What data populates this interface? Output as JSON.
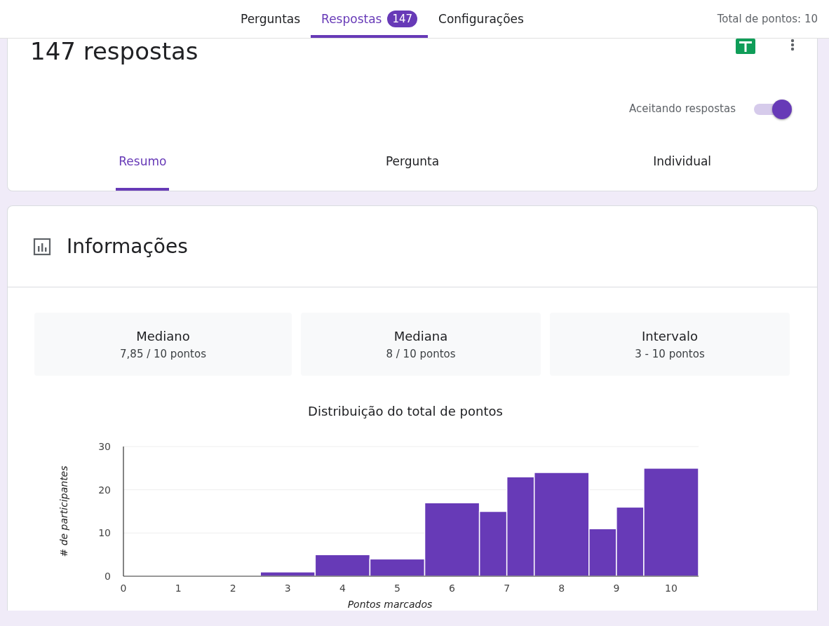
{
  "top_tabs": [
    {
      "label": "Perguntas",
      "selected": false
    },
    {
      "label": "Respostas",
      "selected": true,
      "badge": "147"
    },
    {
      "label": "Configurações",
      "selected": false
    }
  ],
  "total_points": "Total de pontos: 10",
  "header": {
    "title": "147 respostas",
    "accepting": {
      "label": "Aceitando respostas",
      "on": true
    }
  },
  "sub_tabs": [
    {
      "label": "Resumo",
      "selected": true
    },
    {
      "label": "Pergunta",
      "selected": false
    },
    {
      "label": "Individual",
      "selected": false
    }
  ],
  "insights": {
    "title": "Informações",
    "stats": [
      {
        "label": "Mediano",
        "value": "7,85 / 10 pontos"
      },
      {
        "label": "Mediana",
        "value": "8 / 10 pontos"
      },
      {
        "label": "Intervalo",
        "value": "3 - 10 pontos"
      }
    ],
    "chart_data": {
      "type": "bar",
      "title": "Distribuição do total de pontos",
      "xlabel": "Pontos marcados",
      "ylabel": "# de participantes",
      "x": [
        3,
        4,
        5,
        6,
        6.75,
        7.25,
        8,
        8.75,
        9.25,
        10
      ],
      "values": [
        1,
        5,
        4,
        17,
        15,
        23,
        24,
        11,
        16,
        25
      ],
      "color": "#673ab7",
      "xlim": [
        0,
        10.5
      ],
      "ylim": [
        0,
        30
      ],
      "xticks": [
        0,
        1,
        2,
        3,
        4,
        5,
        6,
        7,
        8,
        9,
        10
      ],
      "yticks": [
        0,
        10,
        20,
        30
      ]
    }
  }
}
